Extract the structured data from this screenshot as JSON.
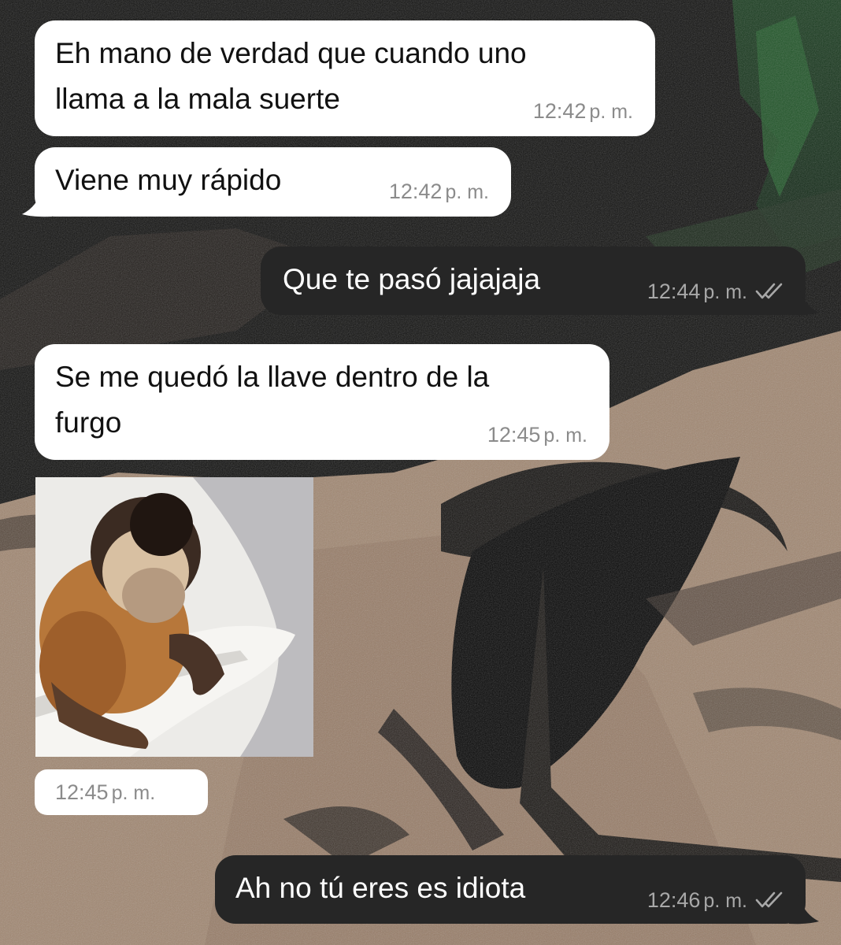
{
  "messages": [
    {
      "direction": "incoming",
      "lines": [
        "Eh mano de verdad que cuando uno",
        "llama a la mala suerte"
      ],
      "time": "12:42",
      "ampm": "p. m."
    },
    {
      "direction": "incoming",
      "lines": [
        "Viene muy rápido"
      ],
      "time": "12:42",
      "ampm": "p. m."
    },
    {
      "direction": "outgoing",
      "lines": [
        "Que te pasó jajajaja"
      ],
      "time": "12:44",
      "ampm": "p. m.",
      "status_icon": "double-check-icon"
    },
    {
      "direction": "incoming",
      "lines": [
        "Se me quedó la llave dentro de la",
        "furgo"
      ],
      "time": "12:45",
      "ampm": "p. m."
    },
    {
      "direction": "incoming",
      "type": "image",
      "image_subject": "monkey-in-bathtub",
      "time": "12:45",
      "ampm": "p. m."
    },
    {
      "direction": "outgoing",
      "lines": [
        "Ah no tú eres es idiota"
      ],
      "time": "12:46",
      "ampm": "p. m.",
      "status_icon": "double-check-icon"
    }
  ],
  "colors": {
    "incoming_bubble": "#ffffff",
    "outgoing_bubble": "#262626",
    "incoming_text": "#111111",
    "outgoing_text": "#ffffff",
    "timestamp": "#8b8b8b"
  }
}
